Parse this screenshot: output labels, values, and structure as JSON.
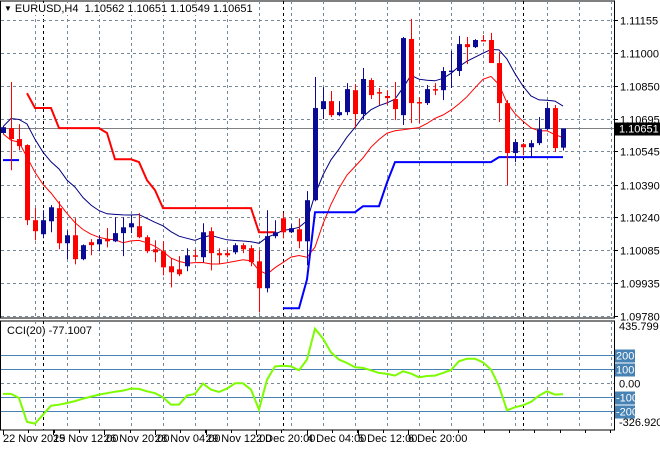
{
  "header": {
    "menu_icon": "triangle-down-icon",
    "symbol": "EURUSD,H4",
    "open": "1.10562",
    "high": "1.10651",
    "low": "1.10549",
    "close": "1.10651"
  },
  "indicator": {
    "label": "CCI(20)",
    "value": "-77.1007"
  },
  "colors": {
    "bull": "#0a0a96",
    "bear": "#ff0000",
    "ma_upper": "#000080",
    "ma_lower": "#ff0000",
    "stop_upper": "#ff0000",
    "stop_lower": "#0000ff",
    "cci": "#7cfc00",
    "level": "#4682b4",
    "grid": "#778899"
  },
  "chart_data": [
    {
      "type": "candlestick",
      "title": "EURUSD,H4",
      "price_axis_labels": [
        "1.11155",
        "1.11000",
        "1.10850",
        "1.10695",
        "1.10545",
        "1.10390",
        "1.10240",
        "1.10085",
        "1.09935",
        "1.09780"
      ],
      "ylim": [
        1.0978,
        1.11155
      ],
      "current_price": "1.10651",
      "time_axis_labels": [
        "22 Nov 2019",
        "25 Nov 12:00",
        "26 Nov 20:00",
        "28 Nov 04:00",
        "29 Nov 12:00",
        "2 Dec 20:00",
        "4 Dec 04:00",
        "5 Dec 12:00",
        "6 Dec 20:00"
      ],
      "ohlc": [
        [
          1.1063,
          1.1066,
          1.10627,
          1.10657
        ],
        [
          1.10653,
          1.10867,
          1.10457,
          1.10602
        ],
        [
          1.10602,
          1.10671,
          1.1055,
          1.10569
        ],
        [
          1.10574,
          1.10578,
          1.10202,
          1.10225
        ],
        [
          1.10225,
          1.10281,
          1.10132,
          1.10174
        ],
        [
          1.1016,
          1.10271,
          1.10141,
          1.10225
        ],
        [
          1.1022,
          1.10295,
          1.10169,
          1.10285
        ],
        [
          1.10281,
          1.10313,
          1.1009,
          1.10118
        ],
        [
          1.10118,
          1.10178,
          1.10044,
          1.10155
        ],
        [
          1.10155,
          1.10234,
          1.1002,
          1.10044
        ],
        [
          1.10044,
          1.10113,
          1.10039,
          1.10109
        ],
        [
          1.10123,
          1.10137,
          1.10062,
          1.10109
        ],
        [
          1.10113,
          1.10155,
          1.10081,
          1.10137
        ],
        [
          1.10137,
          1.10188,
          1.10099,
          1.10127
        ],
        [
          1.10127,
          1.10239,
          1.10123,
          1.10165
        ],
        [
          1.10165,
          1.10239,
          1.10058,
          1.10192
        ],
        [
          1.10192,
          1.10248,
          1.10165,
          1.10211
        ],
        [
          1.10197,
          1.10258,
          1.10141,
          1.10146
        ],
        [
          1.10146,
          1.10155,
          1.10072,
          1.10081
        ],
        [
          1.1009,
          1.10132,
          1.1003,
          1.10076
        ],
        [
          1.10081,
          1.10127,
          1.09969,
          1.10006
        ],
        [
          1.10011,
          1.10048,
          1.09913,
          1.09983
        ],
        [
          1.09997,
          1.10058,
          1.09965,
          1.09974
        ],
        [
          1.10011,
          1.10095,
          1.09988,
          1.10062
        ],
        [
          1.10062,
          1.1009,
          1.10039,
          1.10058
        ],
        [
          1.10053,
          1.10211,
          1.1003,
          1.10169
        ],
        [
          1.10174,
          1.10192,
          1.09992,
          1.10072
        ],
        [
          1.10072,
          1.10095,
          1.1002,
          1.10062
        ],
        [
          1.10072,
          1.1009,
          1.10053,
          1.10062
        ],
        [
          1.10076,
          1.10118,
          1.10067,
          1.10109
        ],
        [
          1.10109,
          1.10118,
          1.10072,
          1.1009
        ],
        [
          1.10095,
          1.10109,
          1.10011,
          1.1003
        ],
        [
          1.10034,
          1.10085,
          1.09797,
          1.09909
        ],
        [
          1.09909,
          1.10271,
          1.0989,
          1.10151
        ],
        [
          1.10151,
          1.10225,
          1.10141,
          1.10169
        ],
        [
          1.10234,
          1.10258,
          1.10141,
          1.10169
        ],
        [
          1.10169,
          1.10206,
          1.10165,
          1.10188
        ],
        [
          1.10183,
          1.10234,
          1.10095,
          1.10127
        ],
        [
          1.10127,
          1.1036,
          1.10016,
          1.10318
        ],
        [
          1.10318,
          1.1089,
          1.10313,
          1.10746
        ],
        [
          1.10741,
          1.10843,
          1.10695,
          1.10778
        ],
        [
          1.10778,
          1.10825,
          1.10704,
          1.10713
        ],
        [
          1.10713,
          1.10778,
          1.10708,
          1.10727
        ],
        [
          1.10727,
          1.10862,
          1.10713,
          1.10834
        ],
        [
          1.10829,
          1.10857,
          1.10653,
          1.10718
        ],
        [
          1.10718,
          1.10932,
          1.10695,
          1.10881
        ],
        [
          1.10876,
          1.10885,
          1.10788,
          1.10806
        ],
        [
          1.1082,
          1.10839,
          1.1076,
          1.10816
        ],
        [
          1.10802,
          1.10829,
          1.1076,
          1.10792
        ],
        [
          1.10788,
          1.10867,
          1.1069,
          1.10741
        ],
        [
          1.10713,
          1.11076,
          1.10667,
          1.11071
        ],
        [
          1.11067,
          1.1116,
          1.10676,
          1.10769
        ],
        [
          1.10774,
          1.10797,
          1.10676,
          1.10769
        ],
        [
          1.10769,
          1.10853,
          1.1076,
          1.10834
        ],
        [
          1.10834,
          1.10862,
          1.10806,
          1.10829
        ],
        [
          1.10829,
          1.10936,
          1.10783,
          1.10918
        ],
        [
          1.10918,
          1.11011,
          1.10839,
          1.1092
        ],
        [
          1.10918,
          1.11081,
          1.10895,
          1.11043
        ],
        [
          1.11043,
          1.11076,
          1.1095,
          1.11029
        ],
        [
          1.11029,
          1.11066,
          1.11025,
          1.11062
        ],
        [
          1.11062,
          1.11085,
          1.11057,
          1.11057
        ],
        [
          1.11062,
          1.11095,
          1.10955,
          1.10955
        ],
        [
          1.10955,
          1.11006,
          1.10681,
          1.10769
        ],
        [
          1.10769,
          1.10783,
          1.10388,
          1.10537
        ],
        [
          1.10537,
          1.10602,
          1.10495,
          1.10588
        ],
        [
          1.10578,
          1.10583,
          1.10527,
          1.10564
        ],
        [
          1.10564,
          1.10597,
          1.10518,
          1.10583
        ],
        [
          1.10583,
          1.10704,
          1.10574,
          1.10648
        ],
        [
          1.10648,
          1.10774,
          1.10643,
          1.10746
        ],
        [
          1.10746,
          1.1076,
          1.10541,
          1.1056
        ],
        [
          1.10562,
          1.10651,
          1.10549,
          1.10651
        ]
      ],
      "ma_upper": {
        "source": "high",
        "period": 10
      },
      "ma_lower": {
        "source": "low",
        "period": 10
      },
      "stop_upper": [
        null,
        null,
        null,
        1.10815,
        1.10746,
        1.10746,
        1.10746,
        1.10653,
        1.10653,
        1.10653,
        1.10653,
        1.10653,
        1.10653,
        1.1063,
        1.10508,
        1.10508,
        1.10508,
        1.10495,
        1.10411,
        1.10365,
        1.10281,
        1.10281,
        1.10281,
        1.10281,
        1.10281,
        1.10281,
        1.10281,
        1.10281,
        1.10281,
        1.10281,
        1.10281,
        1.10281,
        1.10169,
        1.10169,
        1.10169,
        null,
        null,
        null,
        null,
        null,
        null,
        null,
        null,
        null,
        null,
        null,
        null,
        null,
        null,
        null,
        null,
        null,
        null,
        null,
        null,
        null,
        null,
        null,
        null,
        null,
        null,
        null,
        null,
        null,
        null,
        null,
        null,
        null,
        null,
        null,
        null
      ],
      "stop_lower": [
        1.10504,
        1.10504,
        1.10504,
        null,
        null,
        null,
        null,
        null,
        null,
        null,
        null,
        null,
        null,
        null,
        null,
        null,
        null,
        null,
        null,
        null,
        null,
        null,
        null,
        null,
        null,
        null,
        null,
        null,
        null,
        null,
        null,
        null,
        null,
        null,
        null,
        1.09816,
        1.09816,
        1.09816,
        1.0995,
        1.10262,
        1.10262,
        1.10262,
        1.10262,
        1.10262,
        1.10262,
        1.1029,
        1.1029,
        1.1029,
        1.104,
        1.10495,
        1.10495,
        1.10495,
        1.10495,
        1.10495,
        1.10495,
        1.10495,
        1.10495,
        1.10495,
        1.10495,
        1.10495,
        1.10495,
        1.10495,
        1.10518,
        1.10518,
        1.10518,
        1.10518,
        1.10518,
        1.10518,
        1.10518,
        1.10518,
        1.10518
      ]
    },
    {
      "type": "line",
      "title": "CCI(20)",
      "ylim": [
        -326.9205,
        435.799
      ],
      "axis_labels": [
        "435.799",
        "0.00",
        "-326.9205"
      ],
      "levels": [
        {
          "value": 200,
          "label": "200"
        },
        {
          "value": 100,
          "label": "100"
        },
        {
          "value": -100,
          "label": "-100"
        },
        {
          "value": -200,
          "label": "-200"
        }
      ],
      "values": [
        -76,
        -76,
        -105,
        -276,
        -288,
        -224,
        -160,
        -153,
        -141,
        -127,
        -110,
        -95,
        -81,
        -71,
        -60,
        -52,
        -38,
        -40,
        -57,
        -71,
        -100,
        -152,
        -152,
        -88,
        -76,
        -2,
        -45,
        -62,
        -38,
        0,
        0,
        -45,
        -188,
        26,
        121,
        125,
        121,
        93,
        169,
        390,
        319,
        221,
        169,
        145,
        114,
        110,
        93,
        74,
        67,
        55,
        86,
        69,
        43,
        52,
        55,
        74,
        95,
        157,
        176,
        176,
        150,
        98,
        -21,
        -193,
        -171,
        -157,
        -133,
        -88,
        -57,
        -81,
        -77.1
      ]
    }
  ]
}
